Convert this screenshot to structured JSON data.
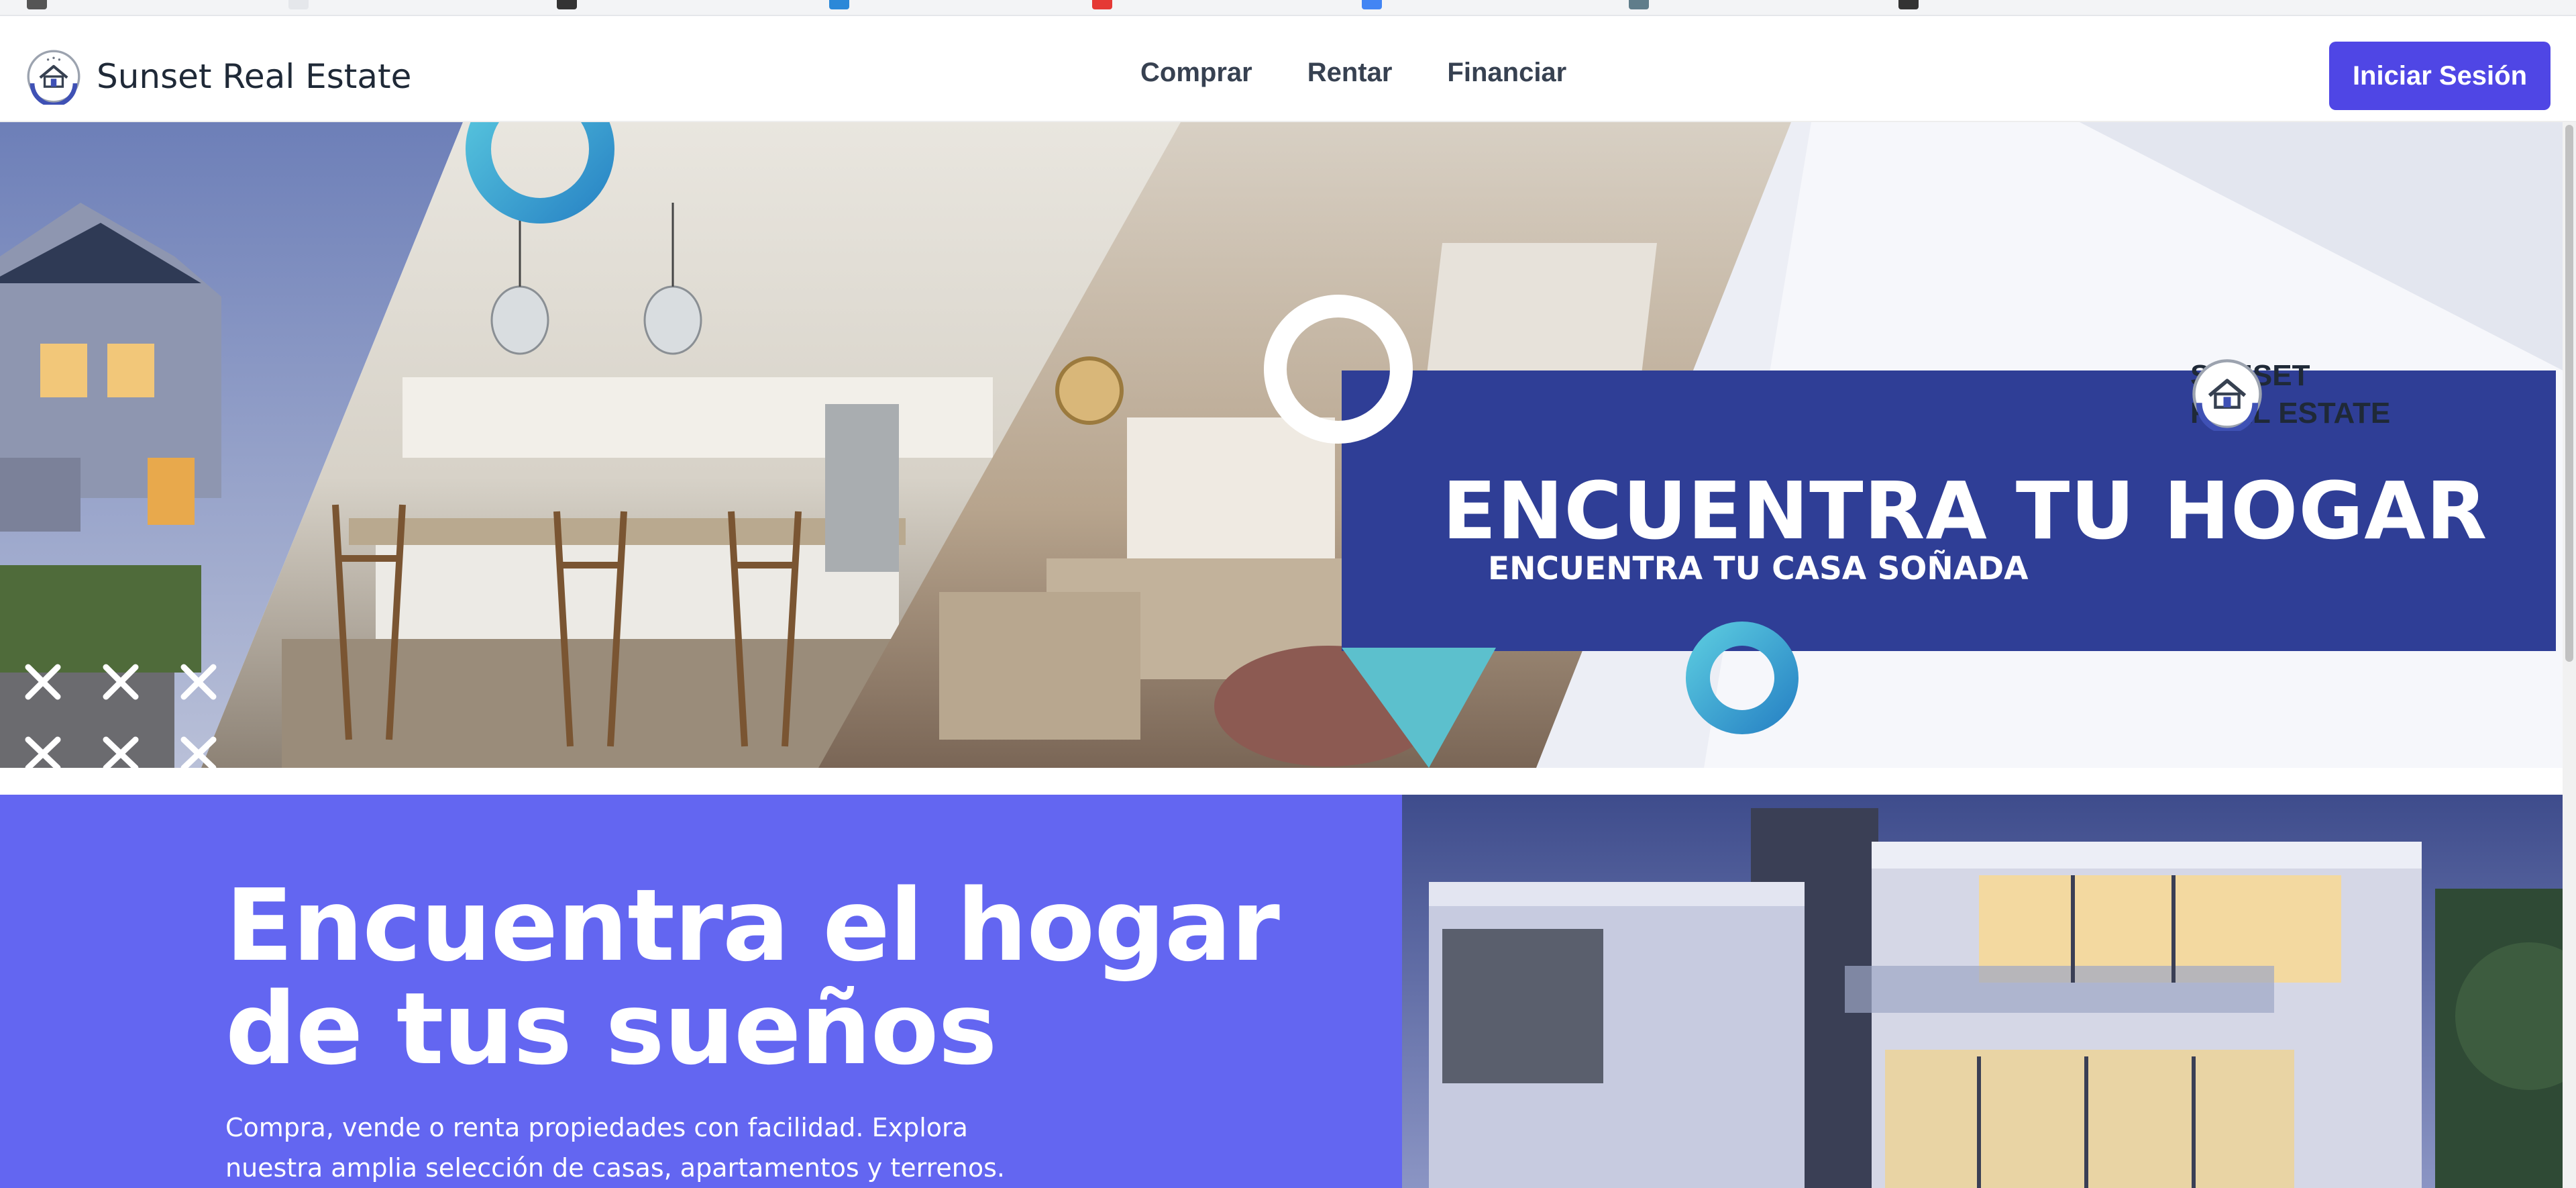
{
  "brand": {
    "name": "Sunset Real Estate"
  },
  "nav": {
    "links": [
      {
        "label": "Comprar"
      },
      {
        "label": "Rentar"
      },
      {
        "label": "Financiar"
      }
    ],
    "login_label": "Iniciar Sesión"
  },
  "banner": {
    "logo_line1": "SUNSET",
    "logo_line2": "REAL ESTATE",
    "title": "ENCUENTRA TU HOGAR",
    "subtitle": "ENCUENTRA TU CASA SOÑADA"
  },
  "promo": {
    "title": "Encuentra el hogar de tus sueños",
    "text": "Compra, vende o renta propiedades con facilidad. Explora nuestra amplia selección de casas, apartamentos y terrenos."
  },
  "colors": {
    "accent": "#4f46e5",
    "promo_bg": "#6366f1",
    "banner_box": "#2f3e96",
    "teal": "#4fb8d0"
  },
  "icons": {
    "brand_logo": "house-circle-icon",
    "banner_logo": "house-circle-icon"
  }
}
